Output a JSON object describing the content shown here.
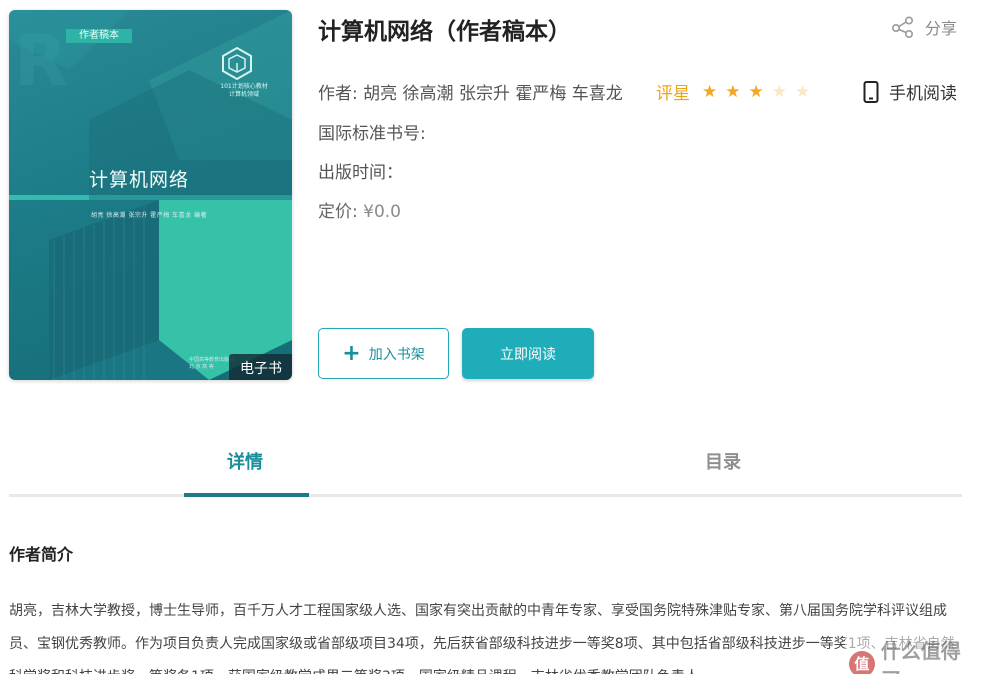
{
  "book": {
    "title": "计算机网络（作者稿本）",
    "authors_line": "作者: 胡亮 徐高潮 张宗升 霍严梅 车喜龙",
    "isbn_label": "国际标准书号:",
    "publish_date_label": "出版时间：",
    "price_label": "定价:",
    "price_value": "¥0.0",
    "rating": {
      "label": "评星",
      "value": 3,
      "max": 5
    }
  },
  "cover": {
    "tag": "作者稿本",
    "series_line1": "101计划核心教材",
    "series_line2": "计算机领域",
    "title": "计算机网络",
    "authors": "胡亮  徐高潮  张宗升  霍严梅  车喜龙  编著",
    "publisher_line1": "中国高等教育出版社",
    "publisher_line2": "北 京 高 等",
    "badge": "电子书"
  },
  "actions": {
    "share_label": "分享",
    "mobile_read_label": "手机阅读",
    "add_shelf_label": "加入书架",
    "read_now_label": "立即阅读"
  },
  "tabs": [
    {
      "label": "详情",
      "active": true
    },
    {
      "label": "目录",
      "active": false
    }
  ],
  "content": {
    "section_title": "作者简介",
    "intro": "胡亮，吉林大学教授，博士生导师，百千万人才工程国家级人选、国家有突出贡献的中青年专家、享受国务院特殊津贴专家、第八届国务院学科评议组成员、宝钢优秀教师。作为项目负责人完成国家级或省部级项目34项，先后获省部级科技进步一等奖8项、其中包括省部级科技进步一等奖1项、吉林省自然科学奖和科技进步奖一等奖各1项、获国家级教学成果二等奖3项、国家级精品课程、吉林省优秀教学团队负责人。"
  },
  "watermark": {
    "logo_char": "值",
    "text": "什么值得买"
  },
  "colors": {
    "accent": "#1fadba",
    "accent_dark": "#1d7a86",
    "star_on": "#f5a623",
    "rating_label": "#f0a318"
  }
}
